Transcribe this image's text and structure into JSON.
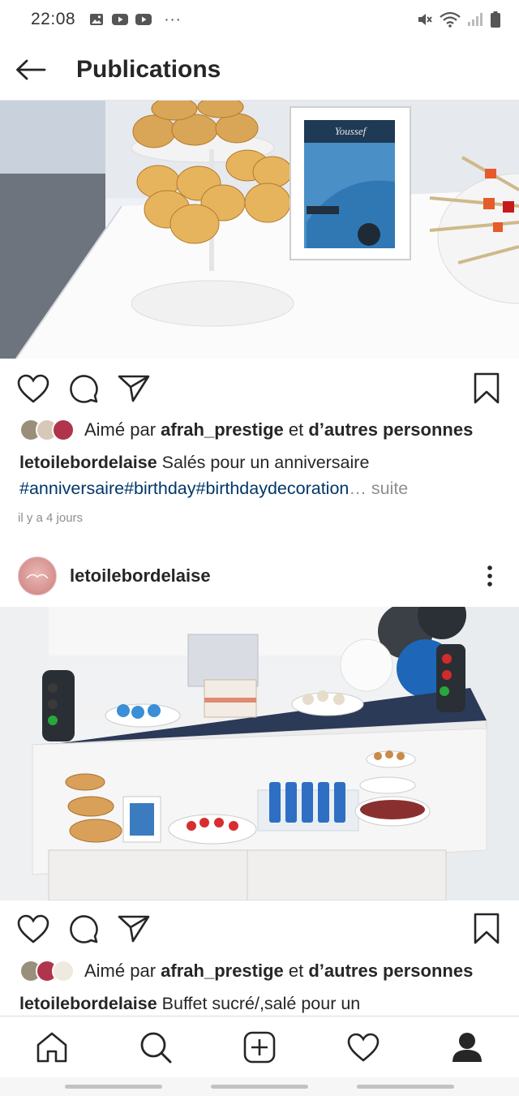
{
  "status_bar": {
    "time": "22:08",
    "more": "···",
    "icons": [
      "gallery-icon",
      "youtube-icon",
      "youtube-icon",
      "mute-icon",
      "wifi-icon",
      "signal-icon",
      "battery-icon"
    ]
  },
  "header": {
    "title": "Publications",
    "back_icon": "arrow-left-icon"
  },
  "post1": {
    "likes_prefix": "Aimé par ",
    "liker": "afrah_prestige",
    "likes_middle": " et ",
    "likes_suffix": "d’autres personnes",
    "author": "letoilebordelaise",
    "caption": " Salés pour un anniversaire",
    "hashtags": "#anniversaire#birthday#birthdaydecoration",
    "more": "… suite",
    "time_ago": "il y a 4 jours",
    "frame_label": "Youssef"
  },
  "post2": {
    "username": "letoilebordelaise",
    "likes_prefix": "Aimé par ",
    "liker": "afrah_prestige",
    "likes_middle": " et ",
    "likes_suffix": "d’autres personnes",
    "author": "letoilebordelaise",
    "caption": " Buffet sucré/,salé pour un"
  },
  "bottom_nav": [
    "home-icon",
    "search-icon",
    "add-post-icon",
    "activity-heart-icon",
    "profile-icon"
  ],
  "colors": {
    "text": "#262626",
    "hashtag": "#00376b",
    "muted": "#8e8e8e",
    "border": "#dbdbdb"
  }
}
